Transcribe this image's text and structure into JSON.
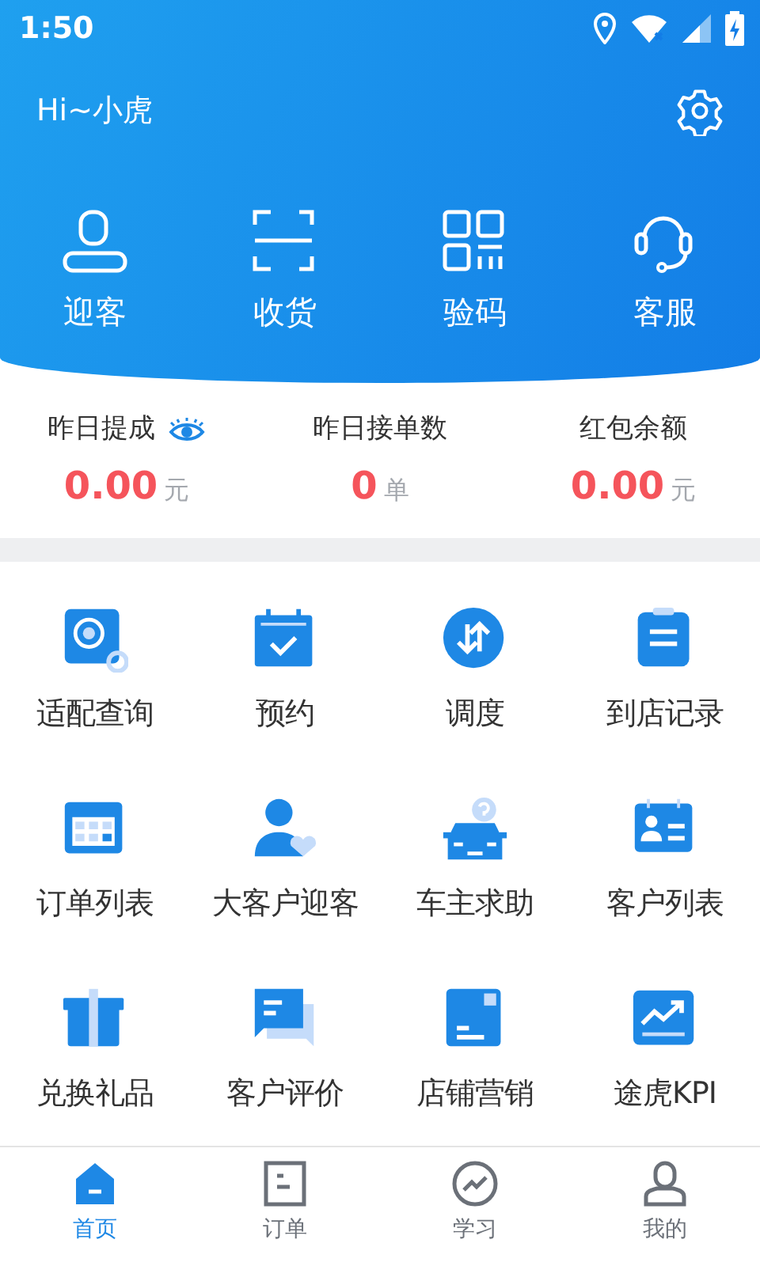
{
  "status_bar": {
    "time": "1:50"
  },
  "header": {
    "greeting": "Hi~小虎"
  },
  "quick_actions": [
    {
      "label": "迎客"
    },
    {
      "label": "收货"
    },
    {
      "label": "验码"
    },
    {
      "label": "客服"
    }
  ],
  "stats": [
    {
      "label": "昨日提成",
      "value": "0.00",
      "unit": "元"
    },
    {
      "label": "昨日接单数",
      "value": "0",
      "unit": "单"
    },
    {
      "label": "红包余额",
      "value": "0.00",
      "unit": "元"
    }
  ],
  "grid": [
    {
      "label": "适配查询"
    },
    {
      "label": "预约"
    },
    {
      "label": "调度"
    },
    {
      "label": "到店记录"
    },
    {
      "label": "订单列表"
    },
    {
      "label": "大客户迎客"
    },
    {
      "label": "车主求助"
    },
    {
      "label": "客户列表"
    },
    {
      "label": "兑换礼品"
    },
    {
      "label": "客户评价"
    },
    {
      "label": "店铺营销"
    },
    {
      "label": "途虎KPI"
    }
  ],
  "bottom_nav": [
    {
      "label": "首页",
      "selected": true
    },
    {
      "label": "订单",
      "selected": false
    },
    {
      "label": "学习",
      "selected": false
    },
    {
      "label": "我的",
      "selected": false
    }
  ]
}
